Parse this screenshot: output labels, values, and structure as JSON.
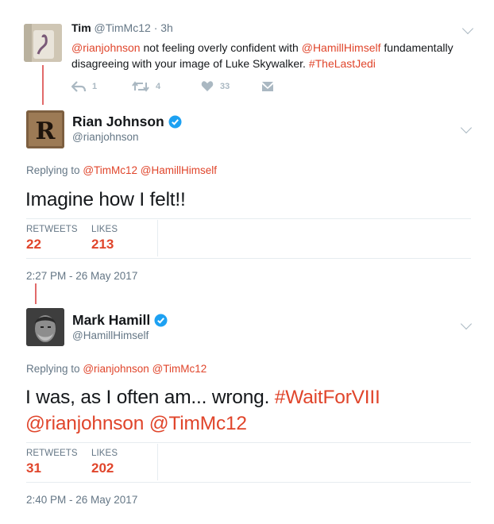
{
  "tweet1": {
    "name": "Tim",
    "handle": "@TimMc12",
    "time": "· 3h",
    "text_parts": [
      {
        "t": "@rianjohnson",
        "link": true
      },
      {
        "t": " not feeling overly confident with ",
        "link": false
      },
      {
        "t": "@HamillHimself",
        "link": true
      },
      {
        "t": " fundamentally disagreeing with your image of Luke Skywalker. ",
        "link": false
      },
      {
        "t": "#TheLastJedi",
        "link": true
      }
    ],
    "actions": {
      "reply": "1",
      "retweet": "4",
      "like": "33"
    }
  },
  "tweet2": {
    "name": "Rian Johnson",
    "handle": "@rianjohnson",
    "avatar_letter": "R",
    "reply_label": "Replying to",
    "reply_to": [
      "@TimMc12",
      "@HamillHimself"
    ],
    "text": "Imagine how I felt!!",
    "retweets_label": "RETWEETS",
    "retweets": "22",
    "likes_label": "LIKES",
    "likes": "213",
    "timestamp": "2:27 PM - 26 May 2017"
  },
  "tweet3": {
    "name": "Mark Hamill",
    "handle": "@HamillHimself",
    "reply_label": "Replying to",
    "reply_to": [
      "@rianjohnson",
      "@TimMc12"
    ],
    "text": "I was, as I often am... wrong. ",
    "hashtag": "#WaitForVIII",
    "mentions": "@rianjohnson @TimMc12",
    "retweets_label": "RETWEETS",
    "retweets": "31",
    "likes_label": "LIKES",
    "likes": "202",
    "timestamp": "2:40 PM - 26 May 2017"
  },
  "colors": {
    "accent": "#e0452b",
    "thread": "#e26a6a",
    "verified": "#1da1f2",
    "muted": "#657786"
  },
  "icons": [
    "reply-icon",
    "retweet-icon",
    "heart-icon",
    "dm-icon",
    "verified-badge-icon",
    "chevron-down-icon"
  ]
}
